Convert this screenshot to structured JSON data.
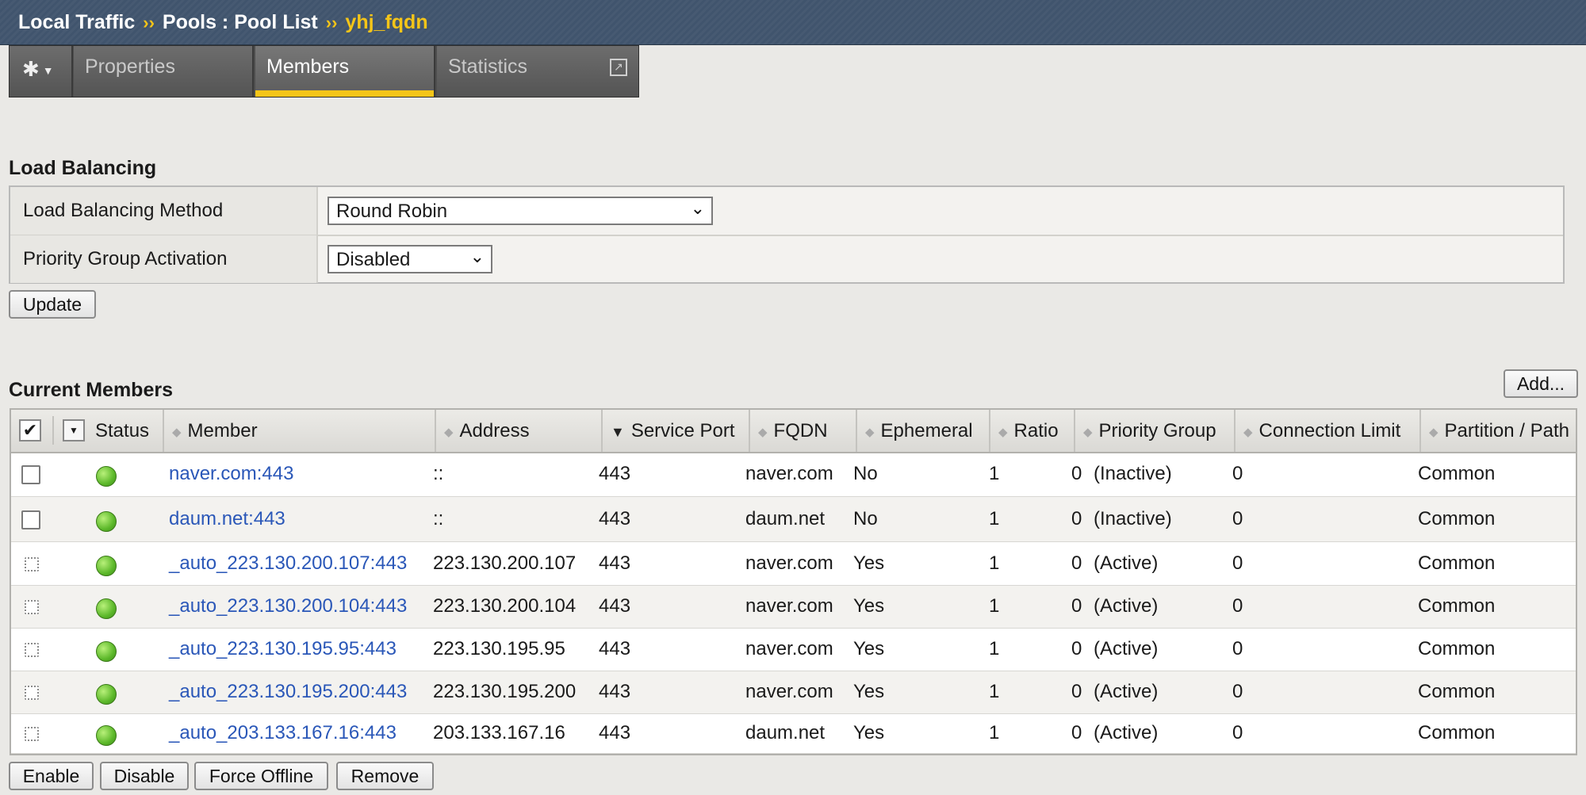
{
  "breadcrumb": {
    "part1": "Local Traffic",
    "sep": "››",
    "part2": "Pools : Pool List",
    "current": "yhj_fqdn"
  },
  "tabs": {
    "gear_icon": "gear-icon",
    "properties": "Properties",
    "members": "Members",
    "statistics": "Statistics"
  },
  "load_balancing": {
    "title": "Load Balancing",
    "method_label": "Load Balancing Method",
    "method_value": "Round Robin",
    "priority_label": "Priority Group Activation",
    "priority_value": "Disabled",
    "update_button": "Update"
  },
  "current_members": {
    "title": "Current Members",
    "add_button": "Add...",
    "columns": {
      "status": "Status",
      "member": "Member",
      "address": "Address",
      "service_port": "Service Port",
      "fqdn": "FQDN",
      "ephemeral": "Ephemeral",
      "ratio": "Ratio",
      "priority_group": "Priority Group",
      "connection_limit": "Connection Limit",
      "partition_path": "Partition / Path"
    },
    "rows": [
      {
        "member": "naver.com:443",
        "address": "::",
        "port": "443",
        "fqdn": "naver.com",
        "ephemeral": "No",
        "ratio": "1",
        "pg_num": "0",
        "pg_state": "(Inactive)",
        "conn_limit": "0",
        "partition": "Common"
      },
      {
        "member": "daum.net:443",
        "address": "::",
        "port": "443",
        "fqdn": "daum.net",
        "ephemeral": "No",
        "ratio": "1",
        "pg_num": "0",
        "pg_state": "(Inactive)",
        "conn_limit": "0",
        "partition": "Common"
      },
      {
        "member": "_auto_223.130.200.107:443",
        "address": "223.130.200.107",
        "port": "443",
        "fqdn": "naver.com",
        "ephemeral": "Yes",
        "ratio": "1",
        "pg_num": "0",
        "pg_state": "(Active)",
        "conn_limit": "0",
        "partition": "Common"
      },
      {
        "member": "_auto_223.130.200.104:443",
        "address": "223.130.200.104",
        "port": "443",
        "fqdn": "naver.com",
        "ephemeral": "Yes",
        "ratio": "1",
        "pg_num": "0",
        "pg_state": "(Active)",
        "conn_limit": "0",
        "partition": "Common"
      },
      {
        "member": "_auto_223.130.195.95:443",
        "address": "223.130.195.95",
        "port": "443",
        "fqdn": "naver.com",
        "ephemeral": "Yes",
        "ratio": "1",
        "pg_num": "0",
        "pg_state": "(Active)",
        "conn_limit": "0",
        "partition": "Common"
      },
      {
        "member": "_auto_223.130.195.200:443",
        "address": "223.130.195.200",
        "port": "443",
        "fqdn": "naver.com",
        "ephemeral": "Yes",
        "ratio": "1",
        "pg_num": "0",
        "pg_state": "(Active)",
        "conn_limit": "0",
        "partition": "Common"
      },
      {
        "member": "_auto_203.133.167.16:443",
        "address": "203.133.167.16",
        "port": "443",
        "fqdn": "daum.net",
        "ephemeral": "Yes",
        "ratio": "1",
        "pg_num": "0",
        "pg_state": "(Active)",
        "conn_limit": "0",
        "partition": "Common"
      }
    ]
  },
  "actions": {
    "enable": "Enable",
    "disable": "Disable",
    "force_offline": "Force Offline",
    "remove": "Remove"
  },
  "colors": {
    "accent": "#f5c518",
    "link": "#2a57b8",
    "status_ok": "#5cb82a",
    "header_bar": "#40546d"
  }
}
